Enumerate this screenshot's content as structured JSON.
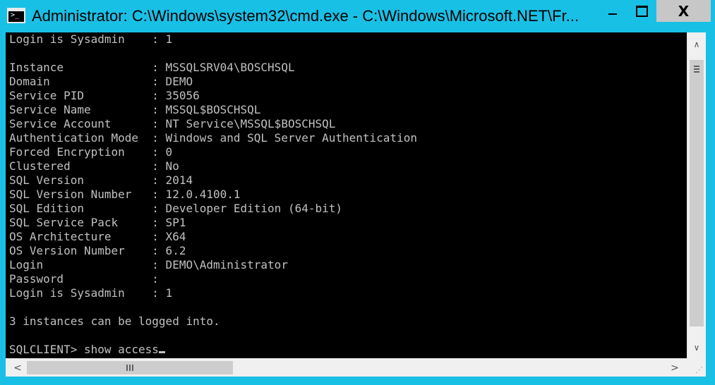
{
  "window": {
    "title": "Administrator: C:\\Windows\\system32\\cmd.exe - C:\\Windows\\Microsoft.NET\\Fr...",
    "icon": "cmd-console-icon",
    "controls": {
      "minimize": "minimize-icon",
      "maximize": "maximize-icon",
      "close": "close-icon",
      "close_label": "X"
    }
  },
  "console": {
    "lines": [
      "Login is Sysadmin    : 1",
      "",
      "Instance             : MSSQLSRV04\\BOSCHSQL",
      "Domain               : DEMO",
      "Service PID          : 35056",
      "Service Name         : MSSQL$BOSCHSQL",
      "Service Account      : NT Service\\MSSQL$BOSCHSQL",
      "Authentication Mode  : Windows and SQL Server Authentication",
      "Forced Encryption    : 0",
      "Clustered            : No",
      "SQL Version          : 2014",
      "SQL Version Number   : 12.0.4100.1",
      "SQL Edition          : Developer Edition (64-bit)",
      "SQL Service Pack     : SP1",
      "OS Architecture      : X64",
      "OS Version Number    : 6.2",
      "Login                : DEMO\\Administrator",
      "Password             :",
      "Login is Sysadmin    : 1",
      "",
      "3 instances can be logged into.",
      "",
      "SQLCLIENT> show access"
    ]
  },
  "scrollbars": {
    "vertical": {
      "up": "chevron-up-icon",
      "down": "chevron-down-icon",
      "up_glyph": "∧",
      "down_glyph": "∨"
    },
    "horizontal": {
      "left": "chevron-left-icon",
      "right": "chevron-right-icon",
      "left_glyph": "<",
      "right_glyph": ">"
    }
  },
  "colors": {
    "frame": "#19c0e6",
    "console_bg": "#000000",
    "console_fg": "#c0c0c0",
    "close_hover": "#c7c7c7"
  }
}
